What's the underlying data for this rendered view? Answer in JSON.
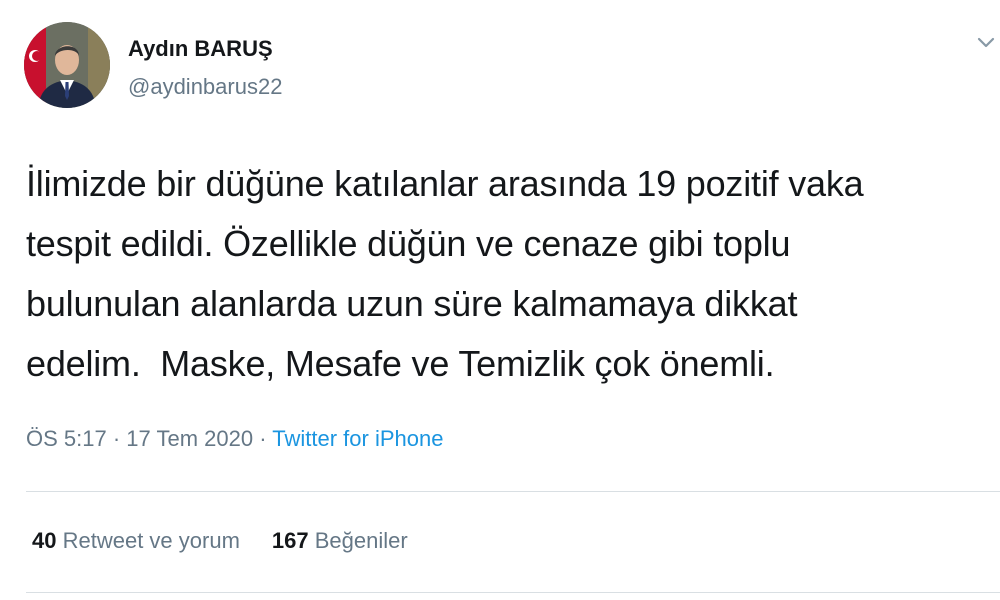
{
  "author": {
    "name": "Aydın BARUŞ",
    "handle": "@aydinbarus22",
    "avatar": "profile-photo"
  },
  "menu_icon": "chevron-down-icon",
  "tweet": {
    "text": "İlimizde bir düğüne katılanlar arasında 19 pozitif vaka\ntespit edildi. Özellikle düğün ve cenaze gibi toplu\nbulunulan alanlarda uzun süre kalmamaya dikkat\nedelim.  Maske, Mesafe ve Temizlik çok önemli."
  },
  "meta": {
    "time": "ÖS 5:17",
    "separator": "·",
    "date": "17 Tem 2020",
    "source": "Twitter for iPhone"
  },
  "stats": {
    "retweets_count": "40",
    "retweets_label": "Retweet ve yorum",
    "likes_count": "167",
    "likes_label": "Beğeniler"
  },
  "colors": {
    "text": "#14171a",
    "secondary": "#657786",
    "link": "#1b95e0",
    "divider": "#d9dfe3"
  }
}
